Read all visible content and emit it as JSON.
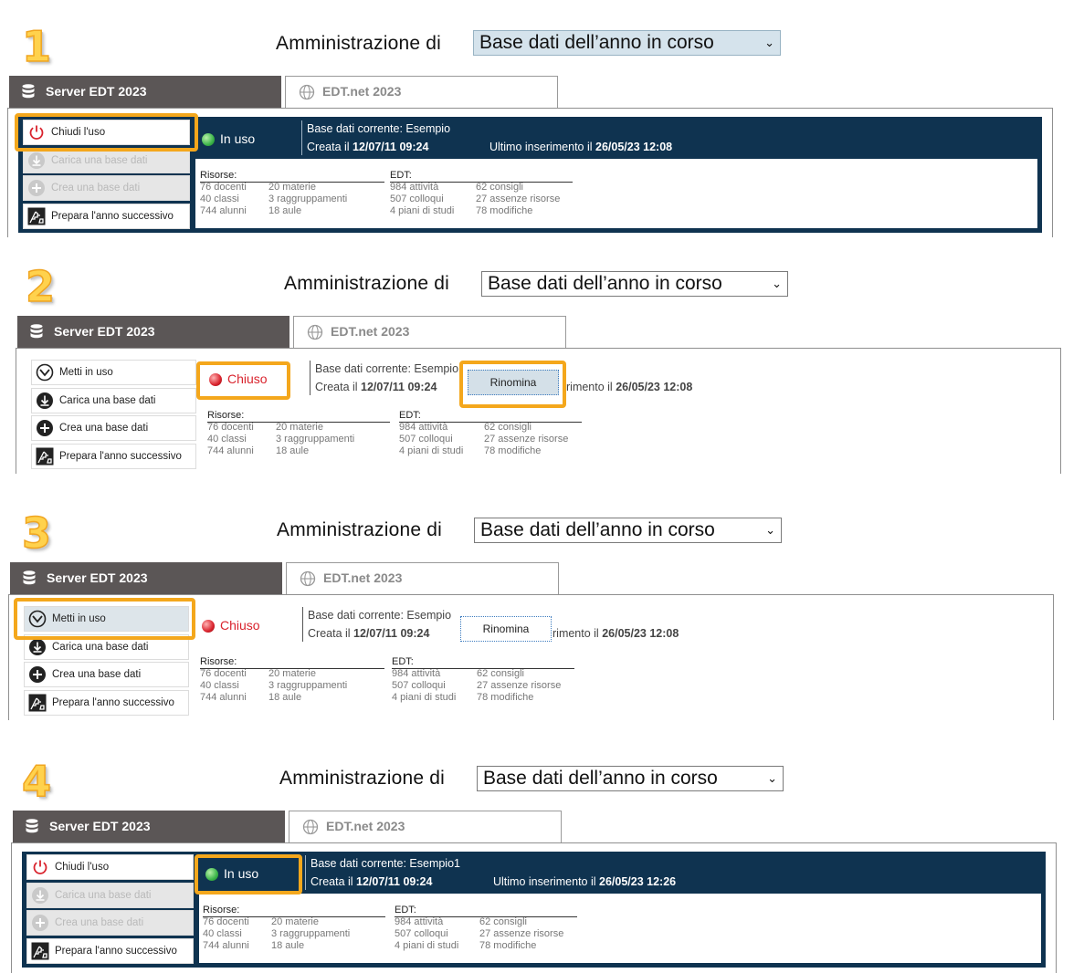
{
  "admin_label": "Amministrazione di",
  "select_value": "Base dati dell’anno in corso",
  "tabs": {
    "server": "Server EDT 2023",
    "net": "EDT.net 2023"
  },
  "menu": {
    "chiudi": "Chiudi l'uso",
    "metti": "Metti in uso",
    "carica": "Carica una base dati",
    "crea": "Crea una base dati",
    "prepara": "Prepara l'anno successivo"
  },
  "status": {
    "in_uso": "In uso",
    "chiuso": "Chiuso"
  },
  "rinomina": "Rinomina",
  "info": {
    "current_label": "Base dati corrente:",
    "created_label": "Creata il",
    "last_label": "Ultimo inserimento il",
    "last_label_partial": "rimento il",
    "created_value": "12/07/11 09:24"
  },
  "stats": {
    "risorse_label": "Risorse:",
    "edt_label": "EDT:",
    "risorse_col1": [
      "76 docenti",
      "40 classi",
      "744 alunni"
    ],
    "risorse_col2": [
      "20 materie",
      "3 raggruppamenti",
      "18 aule"
    ],
    "edt_col1": [
      "984 attività",
      "507 colloqui",
      "4 piani di studi"
    ],
    "edt_col2": [
      "62 consigli",
      "27 assenze risorse",
      "78 modifiche"
    ]
  },
  "steps": [
    {
      "num": "1",
      "db_name": "Esempio",
      "last_value": "26/05/23 12:08"
    },
    {
      "num": "2",
      "db_name": "Esempio",
      "last_value": "26/05/23 12:08"
    },
    {
      "num": "3",
      "db_name": "Esempio",
      "last_value": "26/05/23 12:08"
    },
    {
      "num": "4",
      "db_name": "Esempio1",
      "last_value": "26/05/23 12:26"
    }
  ],
  "colors": {
    "highlight": "#f4a71c",
    "dark_panel": "#0f3350",
    "tab_dark": "#5b5656",
    "green": "#3cb54a",
    "red": "#d9232d"
  }
}
